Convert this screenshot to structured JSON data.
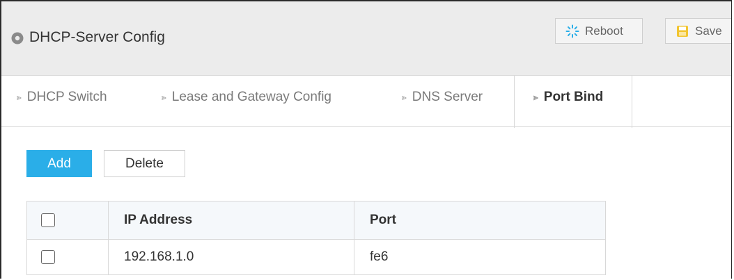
{
  "header": {
    "title": "DHCP-Server Config",
    "reboot_label": "Reboot",
    "save_label": "Save",
    "colors": {
      "background": "#ececec",
      "reboot_icon": "#2aaee8",
      "save_icon": "#f2c530"
    }
  },
  "tabs": [
    {
      "label": "DHCP Switch",
      "active": false
    },
    {
      "label": "Lease and Gateway Config",
      "active": false
    },
    {
      "label": "DNS Server",
      "active": false
    },
    {
      "label": "Port Bind",
      "active": true
    }
  ],
  "actions": {
    "add_label": "Add",
    "delete_label": "Delete",
    "add_color": "#2aaee8"
  },
  "table": {
    "headers": [
      "IP Address",
      "Port"
    ],
    "rows": [
      {
        "ip": "192.168.1.0",
        "port": "fe6",
        "checked": false
      }
    ],
    "header_checked": false
  },
  "icons": {
    "location": "location-pin-icon",
    "reboot": "reboot-spinner-icon",
    "save": "save-disk-icon",
    "tab_arrow": "chevron-right-icon"
  }
}
